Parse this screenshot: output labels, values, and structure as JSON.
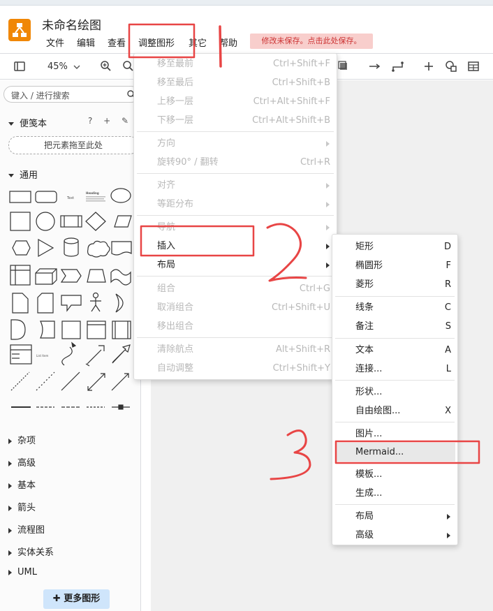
{
  "app": {
    "title": "未命名绘图",
    "save_notice": "修改未保存。点击此处保存。",
    "colors": {
      "accent": "#f08705",
      "warning_bg": "#f8cecc",
      "warning_text": "#cc3333",
      "annotation": "#e84545"
    }
  },
  "menubar": {
    "items": [
      "文件",
      "编辑",
      "查看",
      "调整图形",
      "其它",
      "帮助"
    ]
  },
  "toolbar": {
    "zoom": "45%"
  },
  "sidebar": {
    "search_placeholder": "键入 / 进行搜索",
    "scratchpad": {
      "title": "便笺本",
      "actions": "? + ✎ ✕",
      "dropzone": "把元素拖至此处"
    },
    "general_title": "通用",
    "shape_labels": {
      "text": "Text",
      "heading": "Heading",
      "list_item": "List Item"
    },
    "sections": [
      "杂项",
      "高级",
      "基本",
      "箭头",
      "流程图",
      "实体关系",
      "UML"
    ],
    "more_shapes": "更多图形"
  },
  "arrange_menu": {
    "items": [
      {
        "label": "移至最前",
        "shortcut": "Ctrl+Shift+F",
        "disabled": true
      },
      {
        "label": "移至最后",
        "shortcut": "Ctrl+Shift+B",
        "disabled": true
      },
      {
        "label": "上移一层",
        "shortcut": "Ctrl+Alt+Shift+F",
        "disabled": true
      },
      {
        "label": "下移一层",
        "shortcut": "Ctrl+Alt+Shift+B",
        "disabled": true
      },
      {
        "label": "方向",
        "shortcut": "",
        "disabled": true,
        "submenu": true
      },
      {
        "label": "旋转90° / 翻转",
        "shortcut": "Ctrl+R",
        "disabled": true
      },
      {
        "label": "对齐",
        "shortcut": "",
        "disabled": true,
        "submenu": true
      },
      {
        "label": "等距分布",
        "shortcut": "",
        "disabled": true,
        "submenu": true
      },
      {
        "label": "导航",
        "shortcut": "",
        "disabled": true,
        "submenu": true
      },
      {
        "label": "插入",
        "shortcut": "",
        "disabled": false,
        "submenu": true
      },
      {
        "label": "布局",
        "shortcut": "",
        "disabled": false,
        "submenu": true
      },
      {
        "label": "组合",
        "shortcut": "Ctrl+G",
        "disabled": true
      },
      {
        "label": "取消组合",
        "shortcut": "Ctrl+Shift+U",
        "disabled": true
      },
      {
        "label": "移出组合",
        "shortcut": "",
        "disabled": true
      },
      {
        "label": "清除航点",
        "shortcut": "Alt+Shift+R",
        "disabled": true
      },
      {
        "label": "自动调整",
        "shortcut": "Ctrl+Shift+Y",
        "disabled": true
      }
    ]
  },
  "insert_menu": {
    "items": [
      {
        "label": "矩形",
        "shortcut": "D"
      },
      {
        "label": "椭圆形",
        "shortcut": "F"
      },
      {
        "label": "菱形",
        "shortcut": "R"
      },
      {
        "label": "线条",
        "shortcut": "C"
      },
      {
        "label": "备注",
        "shortcut": "S"
      },
      {
        "label": "文本",
        "shortcut": "A"
      },
      {
        "label": "连接...",
        "shortcut": "L"
      },
      {
        "label": "形状...",
        "shortcut": ""
      },
      {
        "label": "自由绘图...",
        "shortcut": "X"
      },
      {
        "label": "图片...",
        "shortcut": ""
      },
      {
        "label": "Mermaid...",
        "shortcut": "",
        "highlighted": true
      },
      {
        "label": "模板...",
        "shortcut": ""
      },
      {
        "label": "生成...",
        "shortcut": ""
      },
      {
        "label": "布局",
        "shortcut": "",
        "submenu": true
      },
      {
        "label": "高级",
        "shortcut": "",
        "submenu": true
      }
    ]
  }
}
